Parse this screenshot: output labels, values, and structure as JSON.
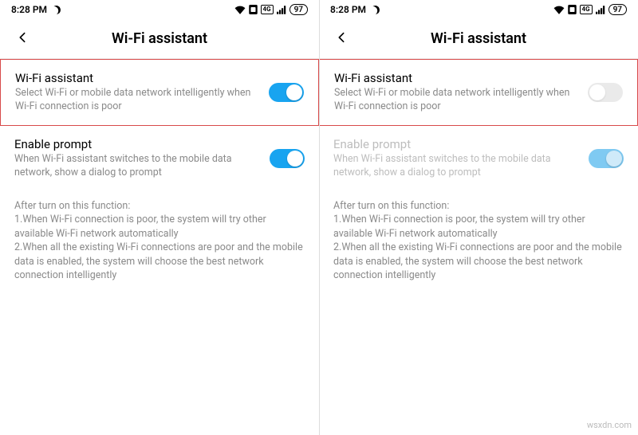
{
  "status": {
    "time": "8:28 PM",
    "network_label": "4G",
    "battery": "97"
  },
  "header": {
    "title": "Wi-Fi assistant"
  },
  "rows": {
    "assistant": {
      "title": "Wi-Fi assistant",
      "desc": "Select Wi-Fi or mobile data network intelligently when Wi-Fi connection is poor"
    },
    "prompt": {
      "title": "Enable prompt",
      "desc": "When Wi-Fi assistant switches to the mobile data network, show a dialog to prompt"
    }
  },
  "info": {
    "intro": "After turn on this function:",
    "line1": "1.When Wi-Fi connection is poor, the system will try other available Wi-Fi network automatically",
    "line2": "2.When all the existing Wi-Fi connections are poor and the mobile data is enabled, the system will choose the best network connection intelligently"
  },
  "watermark": "wsxdn.com"
}
